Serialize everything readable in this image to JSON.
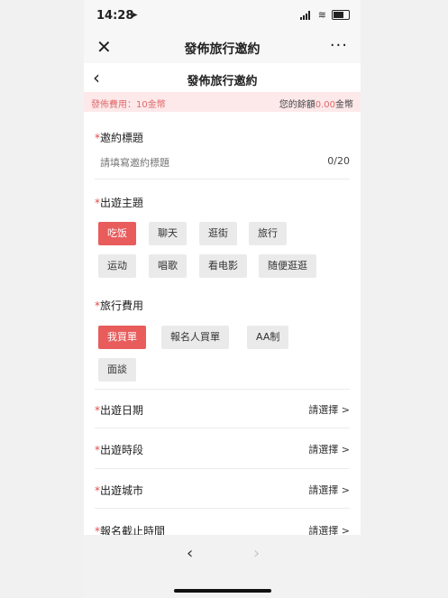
{
  "status": {
    "time": "14:28",
    "location_icon": "location-arrow-icon"
  },
  "wechat": {
    "title": "發佈旅行邀約",
    "close": "✕",
    "more": "···"
  },
  "nav": {
    "back": "‹",
    "title": "發佈旅行邀約"
  },
  "fee": {
    "label": "發佈費用：10金幣",
    "balance_prefix": "您的餘額",
    "balance_amount": "0.00",
    "balance_suffix": "金幣"
  },
  "invite_title": {
    "req": "*",
    "label": "邀約標題",
    "placeholder": "請填寫邀約標題",
    "count": "0/20"
  },
  "theme": {
    "req": "*",
    "label": "出遊主題",
    "tags": [
      "吃饭",
      "聊天",
      "逛街",
      "旅行",
      "运动",
      "唱歌",
      "看电影",
      "随便逛逛"
    ],
    "selected": "吃饭"
  },
  "cost": {
    "req": "*",
    "label": "旅行費用",
    "tags": [
      "我買單",
      "報名人買單",
      "AA制",
      "面談"
    ],
    "selected": "我買單"
  },
  "rows": [
    {
      "req": "*",
      "label": "出遊日期",
      "value": "請選擇 >"
    },
    {
      "req": "*",
      "label": "出遊時段",
      "value": "請選擇 >"
    },
    {
      "req": "*",
      "label": "出遊城市",
      "value": "請選擇 >"
    },
    {
      "req": "*",
      "label": "報名截止時間",
      "value": "請選擇 >"
    }
  ],
  "bottom": {
    "prev": "‹",
    "next": "›"
  }
}
